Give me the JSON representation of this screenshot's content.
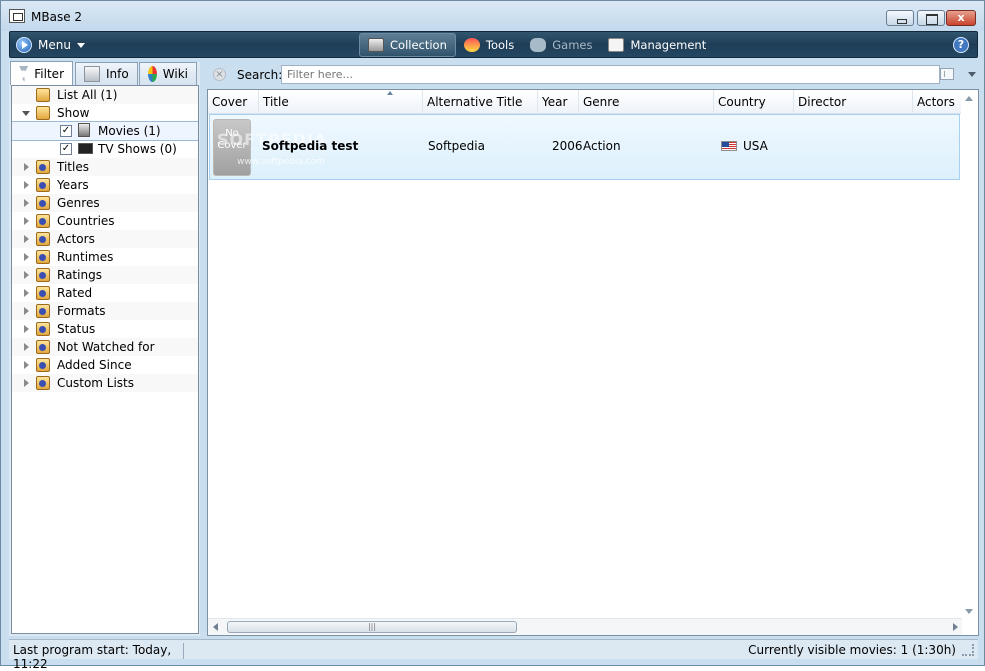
{
  "window": {
    "title": "MBase 2",
    "close_label": "x"
  },
  "menubar": {
    "menu_label": "Menu",
    "nav": [
      {
        "label": "Collection",
        "icon": "collection-icon",
        "active": true
      },
      {
        "label": "Tools",
        "icon": "tools-icon"
      },
      {
        "label": "Games",
        "icon": "games-icon",
        "disabled": true
      },
      {
        "label": "Management",
        "icon": "management-icon"
      }
    ],
    "help_label": "?"
  },
  "left": {
    "tabs": [
      {
        "label": "Filter",
        "icon": "filter-icon",
        "active": true
      },
      {
        "label": "Info",
        "icon": "info-icon"
      },
      {
        "label": "Wiki",
        "icon": "wiki-icon"
      }
    ],
    "tree": [
      {
        "label": "List All (1)",
        "expanded": false,
        "icon": "folder-icon"
      },
      {
        "label": "Show",
        "expanded": true,
        "icon": "folder-icon"
      },
      {
        "label": "Titles",
        "icon": "titles-folder-icon"
      },
      {
        "label": "Years",
        "icon": "years-folder-icon"
      },
      {
        "label": "Genres",
        "icon": "genres-folder-icon"
      },
      {
        "label": "Countries",
        "icon": "countries-folder-icon"
      },
      {
        "label": "Actors",
        "icon": "actors-folder-icon"
      },
      {
        "label": "Runtimes",
        "icon": "runtimes-folder-icon"
      },
      {
        "label": "Ratings",
        "icon": "ratings-folder-icon"
      },
      {
        "label": "Rated",
        "icon": "rated-folder-icon"
      },
      {
        "label": "Formats",
        "icon": "formats-folder-icon"
      },
      {
        "label": "Status",
        "icon": "status-folder-icon"
      },
      {
        "label": "Not Watched for",
        "icon": "not-watched-folder-icon"
      },
      {
        "label": "Added Since",
        "icon": "added-since-folder-icon"
      },
      {
        "label": "Custom Lists",
        "icon": "custom-lists-folder-icon"
      }
    ],
    "show_children": [
      {
        "label": "Movies (1)",
        "checked": true,
        "icon": "movie-icon"
      },
      {
        "label": "TV Shows (0)",
        "checked": true,
        "icon": "tv-icon"
      }
    ],
    "check_mark": "✓"
  },
  "search": {
    "label": "Search:",
    "placeholder": "Filter here...",
    "clear_glyph": "×"
  },
  "table": {
    "columns": [
      "Cover",
      "Title",
      "Alternative Title",
      "Year",
      "Genre",
      "Country",
      "Director",
      "Actors"
    ],
    "rows": [
      {
        "cover_text": "No Cover",
        "title": "Softpedia test",
        "alternative_title": "Softpedia",
        "year": "2006",
        "genre": "Action",
        "country": "USA",
        "director": "",
        "actors": ""
      }
    ],
    "watermark": "SOFTPEDIA",
    "watermark_url": "www.softpedia.com",
    "scroll_thumb": "|||"
  },
  "status": {
    "left": "Last program start: Today, 11:22",
    "right": "Currently visible movies: 1 (1:30h)"
  },
  "colors": {
    "accent": "#244762",
    "selection": "#dcf0fb"
  }
}
